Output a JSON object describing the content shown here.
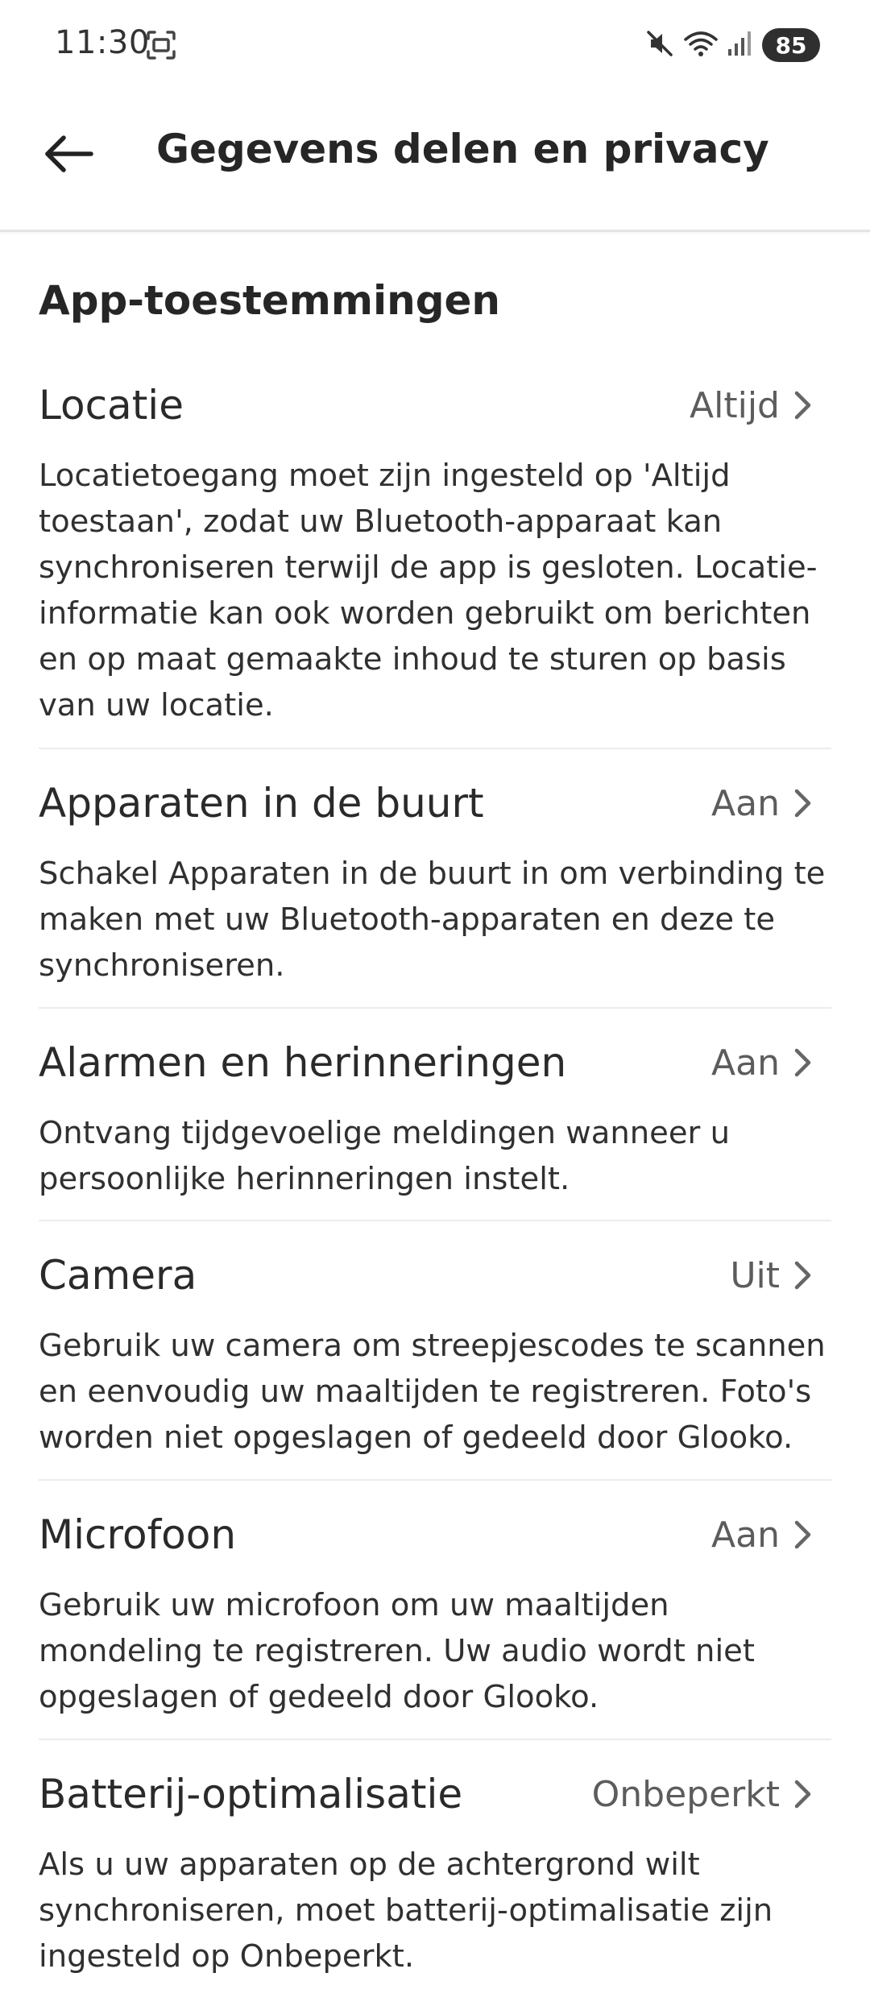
{
  "status_bar": {
    "time": "11:30",
    "battery": "85",
    "icons": [
      "screenshot-icon",
      "mute-icon",
      "wifi-icon",
      "signal-icon"
    ]
  },
  "header": {
    "title": "Gegevens delen en privacy",
    "back_icon": "arrow-left-icon"
  },
  "section": {
    "title": "App-toestemmingen"
  },
  "permissions": [
    {
      "label": "Locatie",
      "value": "Altijd",
      "description": "Locatietoegang moet zijn ingesteld op 'Altijd toestaan', zodat uw Bluetooth-apparaat kan synchroniseren terwijl de app is gesloten. Locatie-informatie kan ook worden gebruikt om berichten en op maat gemaakte inhoud te sturen op basis van uw locatie."
    },
    {
      "label": "Apparaten in de buurt",
      "value": "Aan",
      "description": "Schakel Apparaten in de buurt in om verbinding te maken met uw Bluetooth-apparaten en deze te synchroniseren."
    },
    {
      "label": "Alarmen en herinneringen",
      "value": "Aan",
      "description": "Ontvang tijdgevoelige meldingen wanneer u persoonlijke herinneringen instelt."
    },
    {
      "label": "Camera",
      "value": "Uit",
      "description": "Gebruik uw camera om streepjescodes te scannen en eenvoudig uw maaltijden te registreren. Foto's worden niet opgeslagen of gedeeld door Glooko."
    },
    {
      "label": "Microfoon",
      "value": "Aan",
      "description": "Gebruik uw microfoon om uw maaltijden mondeling te registreren. Uw audio wordt niet opgeslagen of gedeeld door Glooko."
    },
    {
      "label": "Batterij-optimalisatie",
      "value": "Onbeperkt",
      "description": "Als u uw apparaten op de achtergrond wilt synchroniseren, moet batterij-optimalisatie zijn ingesteld op Onbeperkt."
    }
  ]
}
